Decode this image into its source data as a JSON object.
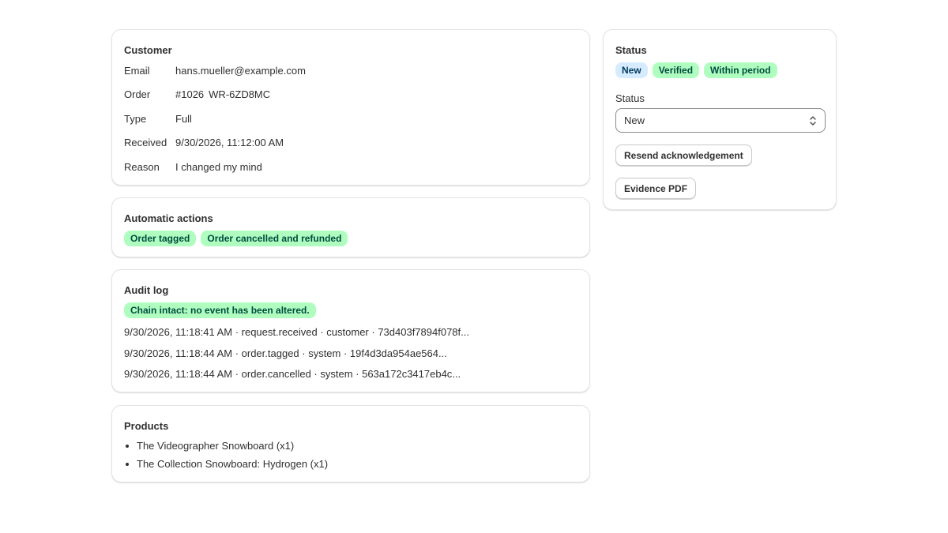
{
  "customer": {
    "title": "Customer",
    "email_label": "Email",
    "email": "hans.mueller@example.com",
    "order_label": "Order",
    "order_number": "#1026",
    "order_ref": "WR-6ZD8MC",
    "type_label": "Type",
    "type": "Full",
    "received_label": "Received",
    "received": "9/30/2026, 11:12:00 AM",
    "reason_label": "Reason",
    "reason": "I changed my mind"
  },
  "automatic_actions": {
    "title": "Automatic actions",
    "badges": [
      "Order tagged",
      "Order cancelled and refunded"
    ]
  },
  "audit_log": {
    "title": "Audit log",
    "chain_badge": "Chain intact: no event has been altered.",
    "entries": [
      "9/30/2026, 11:18:41 AM · request.received · customer · 73d403f7894f078f...",
      "9/30/2026, 11:18:44 AM · order.tagged · system · 19f4d3da954ae564...",
      "9/30/2026, 11:18:44 AM · order.cancelled · system · 563a172c3417eb4c..."
    ]
  },
  "products": {
    "title": "Products",
    "items": [
      "The Videographer Snowboard (x1)",
      "The Collection Snowboard: Hydrogen (x1)"
    ]
  },
  "status_panel": {
    "title": "Status",
    "badges": [
      {
        "label": "New",
        "tone": "blue"
      },
      {
        "label": "Verified",
        "tone": "green"
      },
      {
        "label": "Within period",
        "tone": "green"
      }
    ],
    "select_label": "Status",
    "select_value": "New",
    "resend_button": "Resend acknowledgement",
    "evidence_button": "Evidence PDF"
  },
  "colors": {
    "link": "#005bd3",
    "badge_green": "#affebf",
    "badge_blue": "#d5ebff",
    "border": "#e3e3e3"
  },
  "icons": {
    "select_chevron": "chevron-up-down-icon",
    "bullet": "bullet-icon"
  }
}
